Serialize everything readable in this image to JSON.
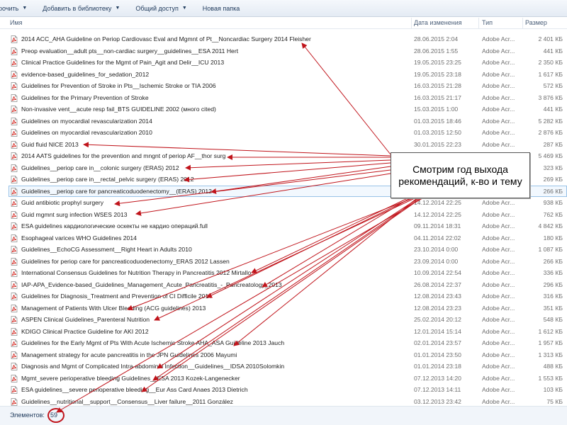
{
  "toolbar": {
    "items": [
      {
        "label": "рочить",
        "has_menu": true
      },
      {
        "label": "Добавить в библиотеку",
        "has_menu": true
      },
      {
        "label": "Общий доступ",
        "has_menu": true
      },
      {
        "label": "Новая папка",
        "has_menu": false
      }
    ]
  },
  "columns": {
    "name": "Имя",
    "date": "Дата изменения",
    "type": "Тип",
    "size": "Размер"
  },
  "files": [
    {
      "name": "2014 ACC_AHA Guideline on Periop Cardiovasc Eval and Mgmnt of Pt__Noncardiac Surgery 2014 Fleisher",
      "date": "28.06.2015 2:04",
      "type": "Adobe Acr...",
      "size": "2 401 КБ"
    },
    {
      "name": "Preop evaluation__adult pts__non-cardiac surgery__guidelines__ESA 2011 Hert",
      "date": "28.06.2015 1:55",
      "type": "Adobe Acr...",
      "size": "441 КБ"
    },
    {
      "name": "Clinical Practice Guidelines for the Mgmt of Pain_Agit and Delir__ICU 2013",
      "date": "19.05.2015 23:25",
      "type": "Adobe Acr...",
      "size": "2 350 КБ"
    },
    {
      "name": "evidence-based_guidelines_for_sedation_2012",
      "date": "19.05.2015 23:18",
      "type": "Adobe Acr...",
      "size": "1 617 КБ"
    },
    {
      "name": "Guidelines for Prevention of Stroke in Pts__Ischemic Stroke or TIA 2006",
      "date": "16.03.2015 21:28",
      "type": "Adobe Acr...",
      "size": "572 КБ"
    },
    {
      "name": "Guidelines for the Primary Prevention of Stroke",
      "date": "16.03.2015 21:17",
      "type": "Adobe Acr...",
      "size": "3 876 КБ"
    },
    {
      "name": "Non-invasive vent__acute resp fail_BTS GUIDELINE 2002 (много cited)",
      "date": "15.03.2015 1:00",
      "type": "Adobe Acr...",
      "size": "441 КБ"
    },
    {
      "name": "Guidelines on myocardial revascularization 2014",
      "date": "01.03.2015 18:46",
      "type": "Adobe Acr...",
      "size": "5 282 КБ"
    },
    {
      "name": "Guidelines on myocardial revascularization 2010",
      "date": "01.03.2015 12:50",
      "type": "Adobe Acr...",
      "size": "2 876 КБ"
    },
    {
      "name": "Guid fluid NICE 2013",
      "date": "30.01.2015 22:23",
      "type": "Adobe Acr...",
      "size": "287 КБ"
    },
    {
      "name": "2014 AATS guidelines for the prevention and mngnt of  periop AF__thor surg",
      "date": "",
      "type": "",
      "size": "5 469 КБ"
    },
    {
      "name": "Guidelines__periop care in__colonic surgery (ERAS) 2012",
      "date": "",
      "type": "",
      "size": "323 КБ"
    },
    {
      "name": "Guidelines__periop care in__rectal_pelvic surgery (ERAS) 2012",
      "date": "",
      "type": "",
      "size": "269 КБ"
    },
    {
      "name": "Guidelines__periop care for pancreaticoduodenectomy__(ERAS) 2012",
      "date": "",
      "type": "",
      "size": "266 КБ"
    },
    {
      "name": "Guid antibiotic prophyl surgery",
      "date": "14.12.2014 22:25",
      "type": "Adobe Acr...",
      "size": "938 КБ"
    },
    {
      "name": "Guid mgmnt surg infection WSES 2013",
      "date": "14.12.2014 22:25",
      "type": "Adobe Acr...",
      "size": "762 КБ"
    },
    {
      "name": "ESA guidelines кардиологические оскекты не кардио операций.full",
      "date": "09.11.2014 18:31",
      "type": "Adobe Acr...",
      "size": "4 842 КБ"
    },
    {
      "name": "Esophageal varices WHO Guidelines 2014",
      "date": "04.11.2014 22:02",
      "type": "Adobe Acr...",
      "size": "180 КБ"
    },
    {
      "name": "Guidelines__EchoCG Assessment__Right Heart in Adults 2010",
      "date": "23.10.2014 0:00",
      "type": "Adobe Acr...",
      "size": "1 087 КБ"
    },
    {
      "name": "Guidelines for periop care for pancreaticoduodenectomy_ERAS 2012 Lassen",
      "date": "23.09.2014 0:00",
      "type": "Adobe Acr...",
      "size": "266 КБ"
    },
    {
      "name": "International Consensus Guidelines for Nutrition Therapy in Pancreatitis 2012 Mirtallo",
      "date": "10.09.2014 22:54",
      "type": "Adobe Acr...",
      "size": "336 КБ"
    },
    {
      "name": "IAP-APA_Evidence-based_Guidelines_Management_Acute_Pancreatitis_-_Pancreatology_2013",
      "date": "26.08.2014 22:37",
      "type": "Adobe Acr...",
      "size": "296 КБ"
    },
    {
      "name": "Guidelines for Diagnosis_Treatment and Prevention of CI Difficile 2014",
      "date": "12.08.2014 23:43",
      "type": "Adobe Acr...",
      "size": "316 КБ"
    },
    {
      "name": "Management of Patients With Ulcer Bleeding (ACG guidelines) 2013",
      "date": "12.08.2014 23:23",
      "type": "Adobe Acr...",
      "size": "351 КБ"
    },
    {
      "name": "ASPEN Clinical Guidelines_Parenteral Nutrition",
      "date": "25.02.2014 20:12",
      "type": "Adobe Acr...",
      "size": "548 КБ"
    },
    {
      "name": "KDIGO Clinical Practice Guideline for AKI 2012",
      "date": "12.01.2014 15:14",
      "type": "Adobe Acr...",
      "size": "1 612 КБ"
    },
    {
      "name": "Guidelines for the Early Mgmt of Pts With Acute Ischemic Stroke AHA_ASA Guideline 2013 Jauch",
      "date": "02.01.2014 23:57",
      "type": "Adobe Acr...",
      "size": "1 957 КБ"
    },
    {
      "name": "Management strategy for acute pancreatitis in the JPN Guidelines 2006 Mayumi",
      "date": "01.01.2014 23:50",
      "type": "Adobe Acr...",
      "size": "1 313 КБ"
    },
    {
      "name": "Diagnosis and Mgmt of Complicated Intra-abdominal Infection__Guidelines__IDSA 2010Solomkin",
      "date": "01.01.2014 23:18",
      "type": "Adobe Acr...",
      "size": "488 КБ"
    },
    {
      "name": "Mgmt_severe perioperative bleeding Guidelines__ESA 2013 Kozek-Langenecker",
      "date": "07.12.2013 14:20",
      "type": "Adobe Acr...",
      "size": "1 553 КБ"
    },
    {
      "name": "ESA guidelines__severe perioperative bleeding__Eur Ass Card Anaes 2013 Dietrich",
      "date": "07.12.2013 14:11",
      "type": "Adobe Acr...",
      "size": "103 КБ"
    },
    {
      "name": "Guidelines__nutritional__support__Consensus__Liver failure__2011 González",
      "date": "03.12.2013 23:42",
      "type": "Adobe Acr...",
      "size": "75 КБ"
    }
  ],
  "selected_index": 13,
  "status": {
    "label": "Элементов:",
    "count": "59"
  },
  "annotation": {
    "text": "Смотрим год выхода рекомендаций, к-во и тему",
    "color": "#c0141b"
  },
  "colors": {
    "arrow": "#c0141b",
    "toolbar_text": "#1e395b",
    "selection_border": "#99c2e7"
  }
}
